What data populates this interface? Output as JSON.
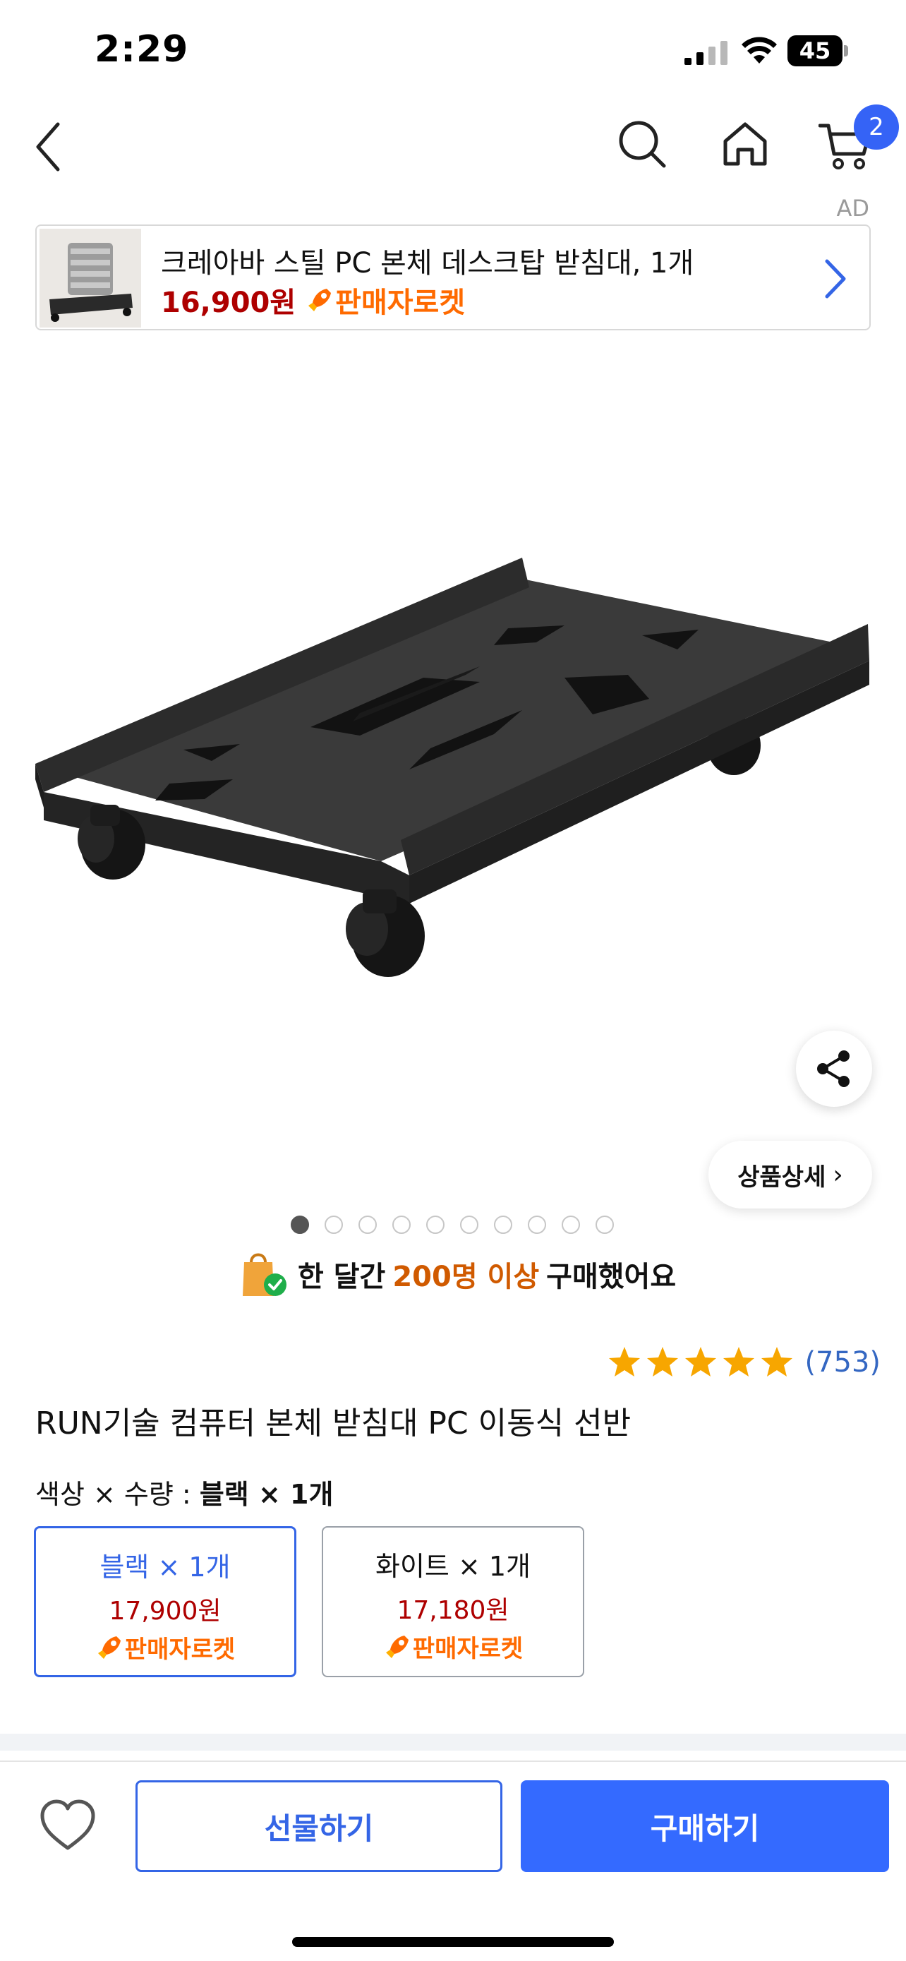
{
  "status_bar": {
    "time": "2:29",
    "battery": "45"
  },
  "nav": {
    "cart_count": "2"
  },
  "ad": {
    "label": "AD",
    "title": "크레아바 스틸 PC 본체 데스크탑 받침대, 1개",
    "price": "16,900원",
    "rocket": "판매자로켓"
  },
  "gallery": {
    "dot_count": 10,
    "active_dot": 1,
    "detail_button": "상품상세"
  },
  "purchased": {
    "prefix": "한 달간",
    "highlight": "200명 이상",
    "suffix": "구매했어요"
  },
  "rating": {
    "stars": 5,
    "review_count": "(753)"
  },
  "product": {
    "title": "RUN기술 컴퓨터 본체 받침대 PC 이동식 선반"
  },
  "options": {
    "summary_label": "색상 × 수량 :",
    "summary_value": "블랙 × 1개",
    "items": [
      {
        "name": "블랙 × 1개",
        "price": "17,900원",
        "rocket": "판매자로켓",
        "selected": true
      },
      {
        "name": "화이트 × 1개",
        "price": "17,180원",
        "rocket": "판매자로켓",
        "selected": false
      }
    ]
  },
  "bottom_bar": {
    "gift_label": "선물하기",
    "buy_label": "구매하기"
  },
  "colors": {
    "accent": "#346aff",
    "price_red": "#ae0000",
    "rocket_orange": "#ff6a00",
    "highlight_orange": "#d05a00"
  }
}
